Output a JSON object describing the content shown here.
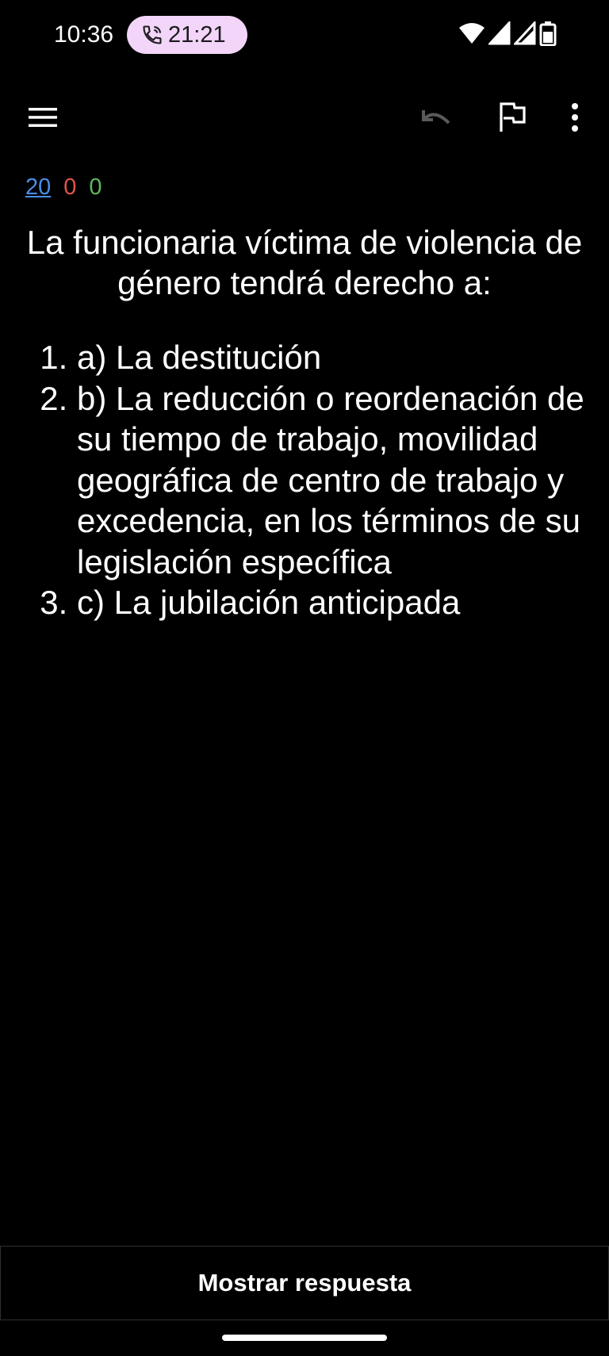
{
  "status_bar": {
    "time": "10:36",
    "call_timer": "21:21",
    "icons": [
      "phone-call-icon",
      "wifi-icon",
      "signal-icon",
      "signal-icon",
      "battery-icon"
    ]
  },
  "toolbar": {
    "icons": [
      "hamburger-menu-icon",
      "undo-icon",
      "flag-icon",
      "more-vert-icon"
    ]
  },
  "counts": {
    "new": "20",
    "learning": "0",
    "review": "0",
    "colors": {
      "new": "#4a8fe7",
      "learning": "#e0554c",
      "review": "#5cb85c"
    }
  },
  "card": {
    "question": "La funcionaria víctima de violencia de género tendrá derecho a:",
    "options": [
      "a) La destitución",
      "b) La reducción o reordenación de su tiempo de trabajo, movilidad geográfica de centro de trabajo y excedencia, en los términos de su legislación específica",
      "c) La jubilación anticipada"
    ]
  },
  "footer": {
    "show_answer_label": "Mostrar respuesta"
  }
}
